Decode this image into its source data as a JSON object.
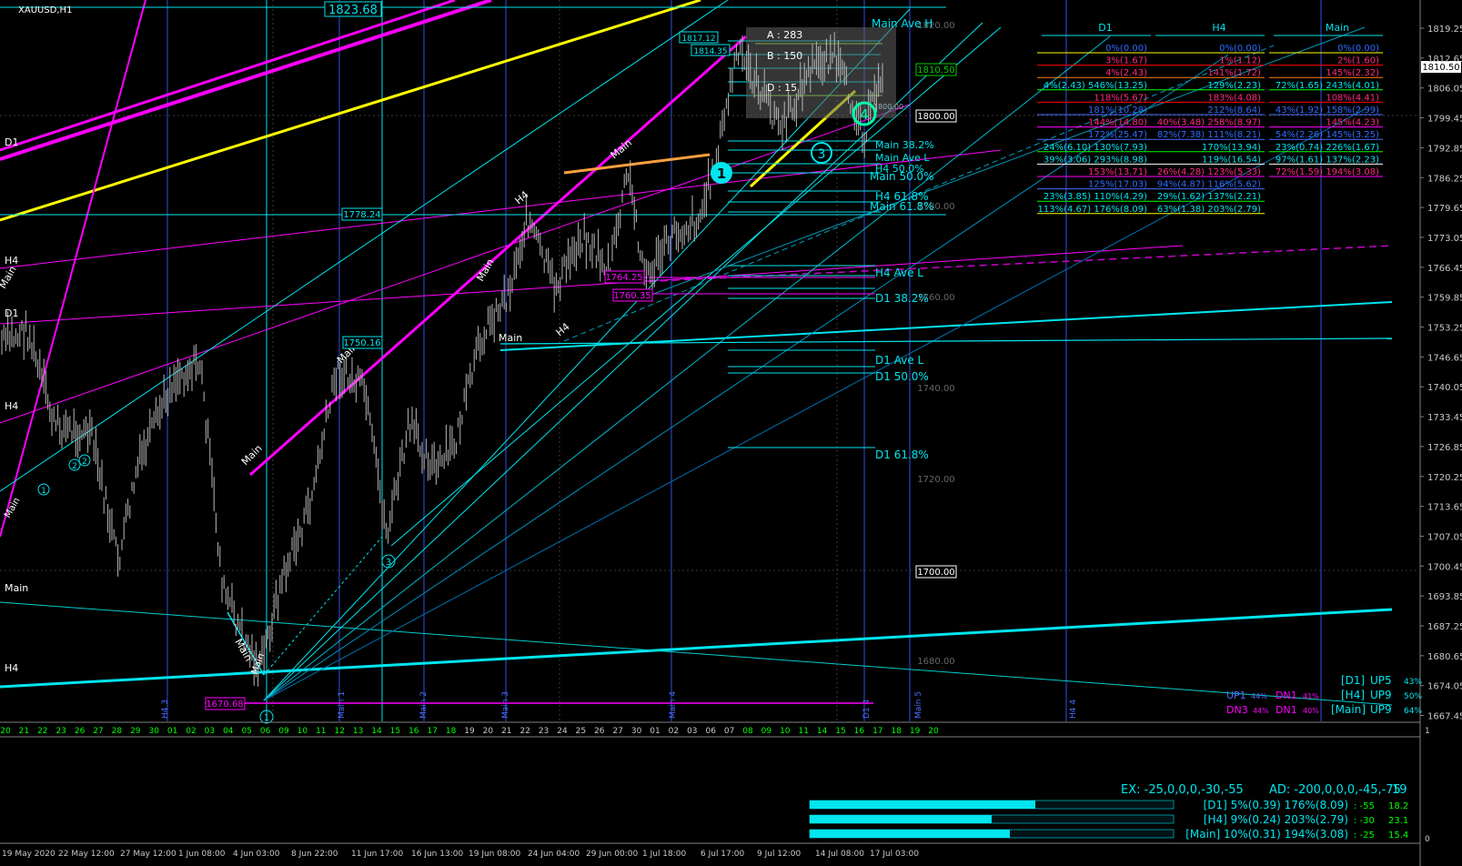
{
  "symbol_title": "XAUUSD,H1",
  "current_price": "1810.50",
  "colors": {
    "bg": "#000000",
    "candle": "#c0c0c0",
    "cyan": "#00e5ee",
    "magenta": "#ff00ff",
    "yellow": "#ffff00",
    "orange": "#ffa040",
    "blue": "#4a6cff",
    "green": "#00ff00",
    "grid": "#3a3a3a"
  },
  "price_axis": {
    "ticks": [
      "1819.25",
      "1812.65",
      "1806.05",
      "1799.45",
      "1792.85",
      "1786.25",
      "1779.65",
      "1773.05",
      "1766.45",
      "1759.85",
      "1753.25",
      "1746.65",
      "1740.05",
      "1733.45",
      "1726.85",
      "1720.25",
      "1713.65",
      "1707.05",
      "1700.45",
      "1693.85",
      "1687.25",
      "1680.65",
      "1674.05",
      "1667.45"
    ],
    "sub_ticks": [
      "1",
      "0"
    ]
  },
  "top_date_axis": [
    "20",
    "21",
    "22",
    "23",
    "26",
    "27",
    "28",
    "29",
    "30",
    "01",
    "02",
    "03",
    "04",
    "05",
    "06",
    "09",
    "10",
    "11",
    "12",
    "13",
    "14",
    "15",
    "16",
    "17",
    "18",
    "19",
    "20",
    "21",
    "22",
    "23",
    "24",
    "25",
    "26",
    "27",
    "30",
    "01",
    "02",
    "03",
    "06",
    "07",
    "08",
    "09",
    "10",
    "11",
    "14",
    "15",
    "16",
    "17",
    "18",
    "19",
    "20"
  ],
  "bottom_date_axis": [
    "19 May 2020",
    "22 May 12:00",
    "27 May 12:00",
    "1 Jun 08:00",
    "4 Jun 03:00",
    "8 Jun 22:00",
    "11 Jun 17:00",
    "16 Jun 13:00",
    "19 Jun 08:00",
    "24 Jun 04:00",
    "29 Jun 00:00",
    "1 Jul 18:00",
    "6 Jul 17:00",
    "9 Jul 12:00",
    "14 Jul 08:00",
    "17 Jul 03:00"
  ],
  "vline_labels": [
    "H4 3",
    "Main 1",
    "Main 2",
    "Main 3",
    "Main 4",
    "D1 4",
    "Main 5",
    "H4 4"
  ],
  "price_boxes": {
    "b1823": "1823.68",
    "b1817a": "1817.12",
    "b1817b": "1814.35",
    "b1778": "1778.24",
    "b1764": "1764.25",
    "b1760": "1760.35",
    "b1750": "1750.16",
    "b1670": "1670.68",
    "r1800": "1800.00",
    "r1810": "1810.50",
    "g1820": "1820.00",
    "g1780": "1780.00",
    "g1760": "1760.00",
    "g1740": "1740.00",
    "g1720": "1720.00",
    "g1700": "1700.00",
    "g1680": "1680.00"
  },
  "fib_labels": {
    "main_ave_h": "Main Ave H",
    "main_382": "Main 38.2%",
    "main_ave_l": "Main Ave L",
    "main_500": "Main 50.0%",
    "h4_500": "H4 50.0%",
    "h4_618": "H4 61.8%",
    "main_618": "Main 61.8%",
    "h4_ave_l": "H4 Ave L",
    "d1_382": "D1 38.2%",
    "d1_ave_l": "D1 Ave L",
    "d1_500": "D1 50.0%",
    "d1_618": "D1 61.8%"
  },
  "abcd": {
    "a": "A : 283",
    "b": "B : 150",
    "d": "D : 15"
  },
  "small_box_text": "1800.00",
  "wave_labels": [
    "Main",
    "H4",
    "Main",
    "H4",
    "Main",
    "Main",
    "Main",
    "Main",
    "H4",
    "Main",
    "Main",
    "D1",
    "H4",
    "H4",
    "D1",
    "H4",
    "Main",
    "Main",
    "H4",
    "D1"
  ],
  "wave_numbers": [
    "1",
    "1",
    "2",
    "2",
    "3",
    "3",
    "4",
    "1"
  ],
  "stats_table": {
    "headers": [
      "D1",
      "H4",
      "Main"
    ],
    "rows": [
      [
        "0%(0.00)",
        "0%(0.00)",
        "0%(0.00)"
      ],
      [
        "3%(1.67)",
        "1%(1.12)",
        "2%(1.60)"
      ],
      [
        "4%(2.43)",
        "141%(1.72)",
        "145%(2.32)"
      ],
      [
        "4%(2.43)  546%(13.25)",
        "129%(2.23)",
        "72%(1.65)  243%(4.01)"
      ],
      [
        "118%(5.67)",
        "183%(4.08)",
        "108%(4.41)"
      ],
      [
        "181%(10.28)",
        "212%(8.64)",
        "43%(1.92)  158%(2.99)"
      ],
      [
        "144%(14.80)",
        "40%(3.48)  258%(8.97)",
        "145%(4.23)"
      ],
      [
        "172%(25.47)",
        "82%(7.38)  111%(8.21)",
        "54%(2.26)  145%(3.25)"
      ],
      [
        "24%(6.10)  130%(7.93)",
        "170%(13.94)",
        "23%(0.74)  226%(1.67)"
      ],
      [
        "39%(3.06)  293%(8.98)",
        "119%(16.54)",
        "97%(1.61)  137%(2.23)"
      ],
      [
        "153%(13.71)",
        "26%(4.28)  123%(5.33)",
        "72%(1.59)  194%(3.08)"
      ],
      [
        "125%(17.03)",
        "94%(4.87)  116%(5.62)",
        ""
      ],
      [
        "23%(3.85)  110%(4.29)",
        "29%(1.62)  137%(2.21)",
        ""
      ],
      [
        "113%(4.67)  176%(8.09)",
        "63%(1.38)  203%(2.79)",
        ""
      ]
    ]
  },
  "status_right": {
    "d1": "[D1]",
    "d1_up": "UP5",
    "d1_pct": "43%",
    "h4": "[H4]",
    "h4_up": "UP9",
    "h4_pct": "50%",
    "main": "[Main]",
    "main_up": "UP9",
    "main_pct": "64%",
    "up1": "UP1",
    "up1_pct": "44%",
    "dn1a": "DN1",
    "dn1a_pct": "41%",
    "dn3": "DN3",
    "dn3_pct": "44%",
    "dn1b": "DN1",
    "dn1b_pct": "40%"
  },
  "indicator_panel": {
    "ex": "EX: -25,0,0,0,-30,-55",
    "ad": "AD: -200,0,0,0,-45,-75",
    "num": "19",
    "rows": [
      {
        "label": "[D1] 5%(0.39)  176%(8.09)",
        "v1": ": -55",
        "v2": "18.2",
        "fill": 0.62
      },
      {
        "label": "[H4] 9%(0.24)  203%(2.79)",
        "v1": ": -30",
        "v2": "23.1",
        "fill": 0.5
      },
      {
        "label": "[Main] 10%(0.31)  194%(3.08)",
        "v1": ": -25",
        "v2": "15.4",
        "fill": 0.55
      }
    ]
  }
}
